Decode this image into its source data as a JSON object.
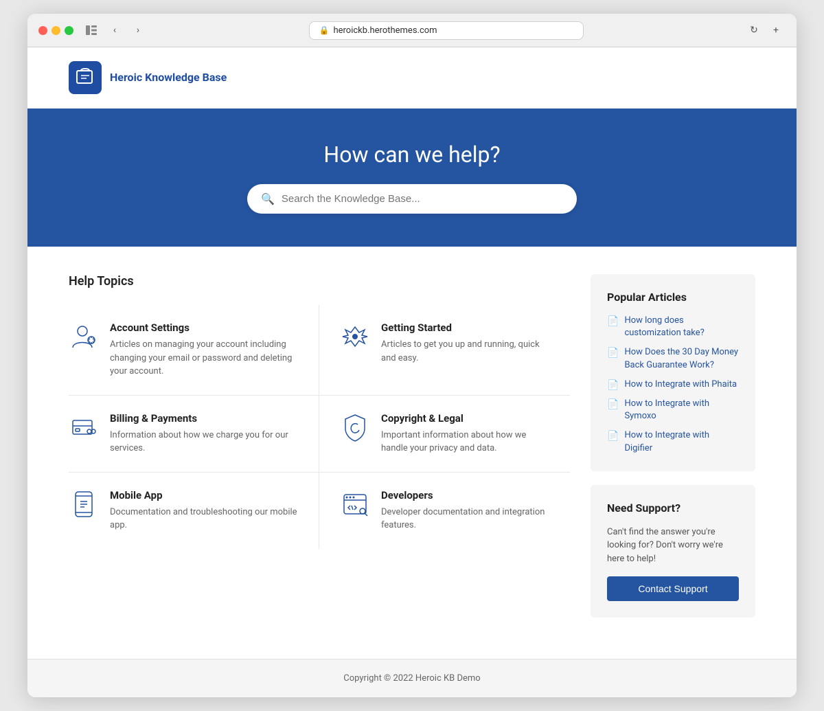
{
  "browser": {
    "url": "heroickb.herothemes.com",
    "dots": [
      "red",
      "yellow",
      "green"
    ]
  },
  "header": {
    "logo_text": "Heroic Knowledge Base",
    "logo_alt": "Heroic KB Logo"
  },
  "hero": {
    "title": "How can we help?",
    "search_placeholder": "Search the Knowledge Base..."
  },
  "help_topics": {
    "section_title": "Help Topics",
    "topics": [
      {
        "id": "account-settings",
        "title": "Account Settings",
        "description": "Articles on managing your account including changing your email or password and deleting your account.",
        "icon": "account"
      },
      {
        "id": "getting-started",
        "title": "Getting Started",
        "description": "Articles to get you up and running, quick and easy.",
        "icon": "rocket"
      },
      {
        "id": "billing-payments",
        "title": "Billing & Payments",
        "description": "Information about how we charge you for our services.",
        "icon": "billing"
      },
      {
        "id": "copyright-legal",
        "title": "Copyright & Legal",
        "description": "Important information about how we handle your privacy and data.",
        "icon": "legal"
      },
      {
        "id": "mobile-app",
        "title": "Mobile App",
        "description": "Documentation and troubleshooting our mobile app.",
        "icon": "mobile"
      },
      {
        "id": "developers",
        "title": "Developers",
        "description": "Developer documentation and integration features.",
        "icon": "developers"
      }
    ]
  },
  "sidebar": {
    "popular_articles": {
      "title": "Popular Articles",
      "articles": [
        "How long does customization take?",
        "How Does the 30 Day Money Back Guarantee Work?",
        "How to Integrate with Phaita",
        "How to Integrate with Symoxo",
        "How to Integrate with Digifier"
      ]
    },
    "need_support": {
      "title": "Need Support?",
      "description": "Can't find the answer you're looking for? Don't worry we're here to help!",
      "button_label": "Contact Support"
    }
  },
  "footer": {
    "text": "Copyright © 2022 Heroic KB Demo"
  }
}
